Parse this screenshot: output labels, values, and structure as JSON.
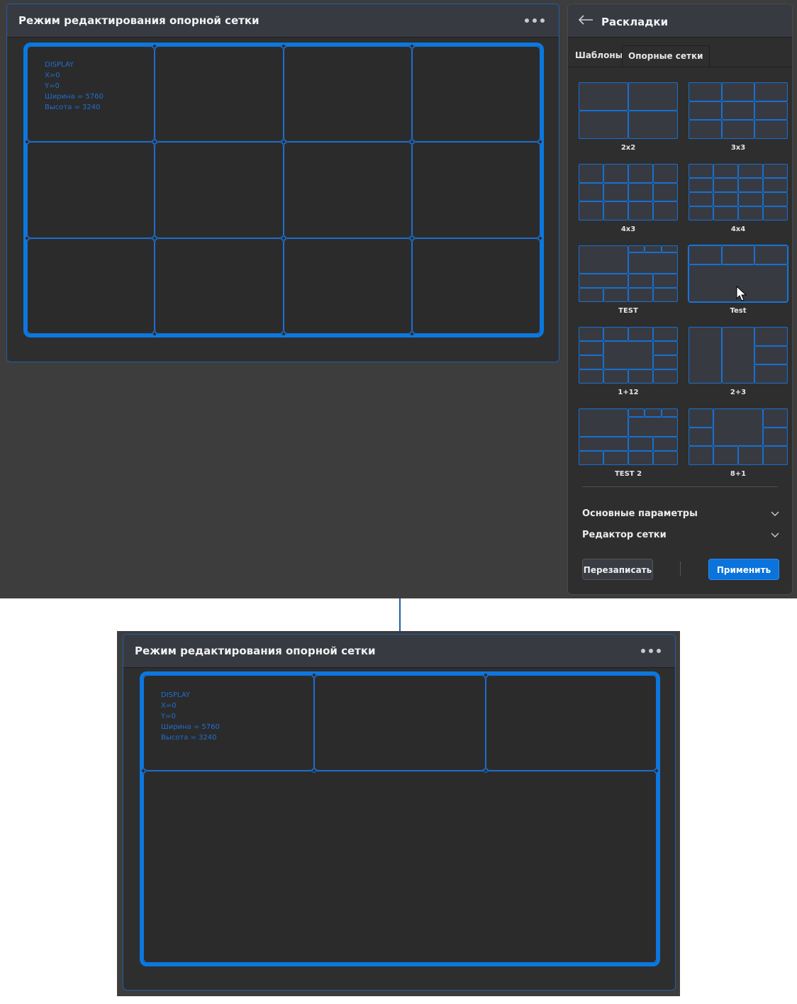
{
  "editor_top": {
    "title": "Режим редактирования опорной сетки",
    "display_info": [
      "DISPLAY",
      "X=0",
      "Y=0",
      "Ширина = 5760",
      "Высота = 3240"
    ]
  },
  "editor_bottom": {
    "title": "Режим редактирования опорной сетки",
    "display_info": [
      "DISPLAY",
      "X=0",
      "Y=0",
      "Ширина = 5760",
      "Высота = 3240"
    ]
  },
  "layouts_panel": {
    "title": "Раскладки",
    "tabs": [
      {
        "label": "Шаблоны",
        "active": false
      },
      {
        "label": "Опорные сетки",
        "active": true
      }
    ],
    "thumbnails": [
      {
        "label": "2x2"
      },
      {
        "label": "3x3"
      },
      {
        "label": "4x3"
      },
      {
        "label": "4x4"
      },
      {
        "label": "TEST"
      },
      {
        "label": "Test",
        "selected": true
      },
      {
        "label": "1+12"
      },
      {
        "label": "2+3"
      },
      {
        "label": "TEST 2"
      },
      {
        "label": "8+1"
      }
    ],
    "sections": [
      {
        "label": "Основные параметры"
      },
      {
        "label": "Редактор сетки"
      }
    ],
    "buttons": {
      "rewrite": "Перезаписать",
      "apply": "Применить"
    }
  },
  "colors": {
    "accent": "#0a78e0",
    "grid_line": "#1a6fd0",
    "background": "#3d3d3d",
    "panel": "#2e2e2e"
  }
}
